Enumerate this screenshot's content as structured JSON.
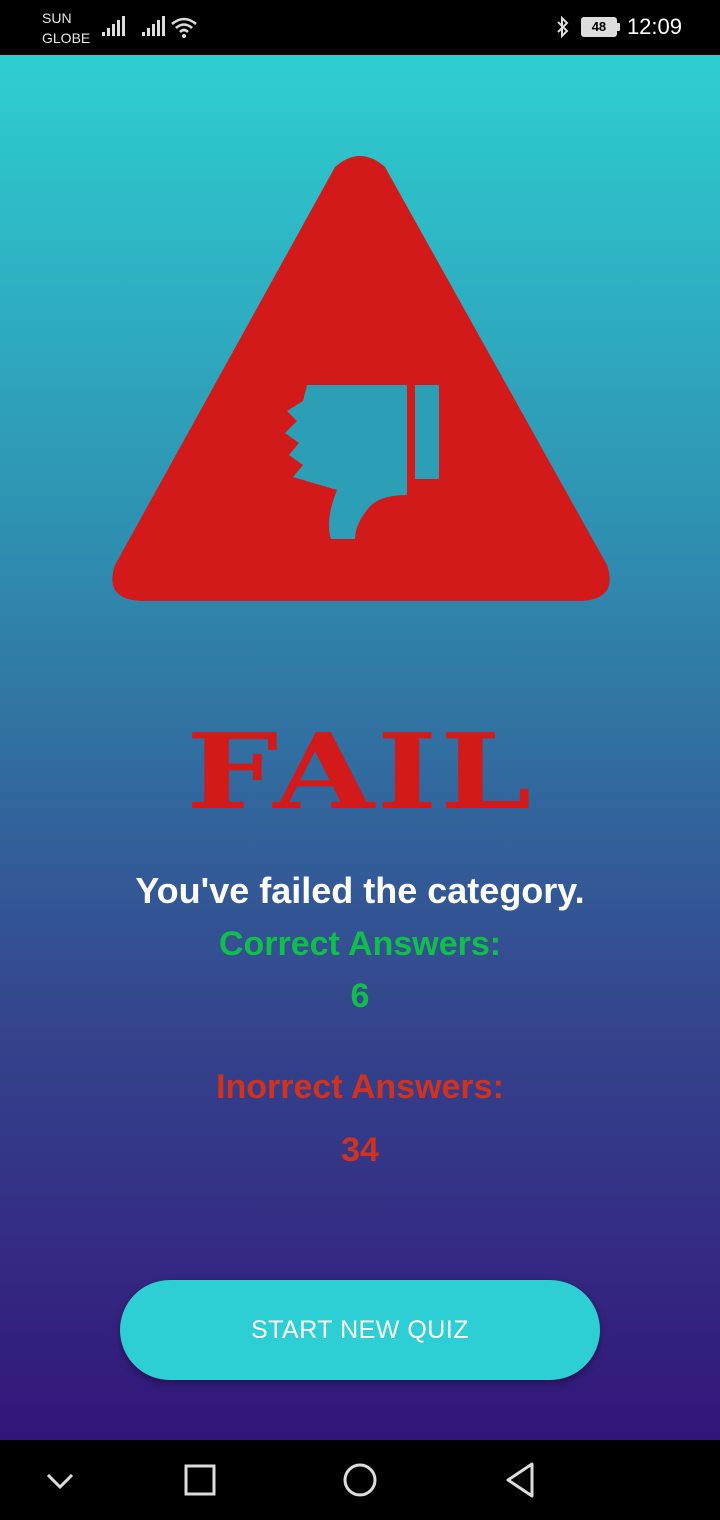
{
  "status_bar": {
    "carrier_1": "SUN",
    "carrier_2": "GLOBE",
    "battery": "48",
    "time": "12:09",
    "icons": [
      "signal-icon",
      "signal-icon",
      "wifi-icon",
      "bluetooth-icon",
      "battery-icon"
    ]
  },
  "result": {
    "icon": "thumbs-down-warning-icon",
    "title": "FAIL",
    "message": "You've failed the category.",
    "correct_label": "Correct Answers:",
    "correct_value": "6",
    "incorrect_label": "Inorrect Answers:",
    "incorrect_value": "34"
  },
  "actions": {
    "start_label": "START NEW QUIZ"
  },
  "nav_bar": {
    "icons": [
      "chevron-down-icon",
      "recents-icon",
      "home-icon",
      "back-icon"
    ]
  },
  "colors": {
    "fail_red": "#d31a1a",
    "correct_green": "#0fbf4a",
    "incorrect_red": "#d1321e",
    "button_cyan": "#2ecfd4"
  }
}
